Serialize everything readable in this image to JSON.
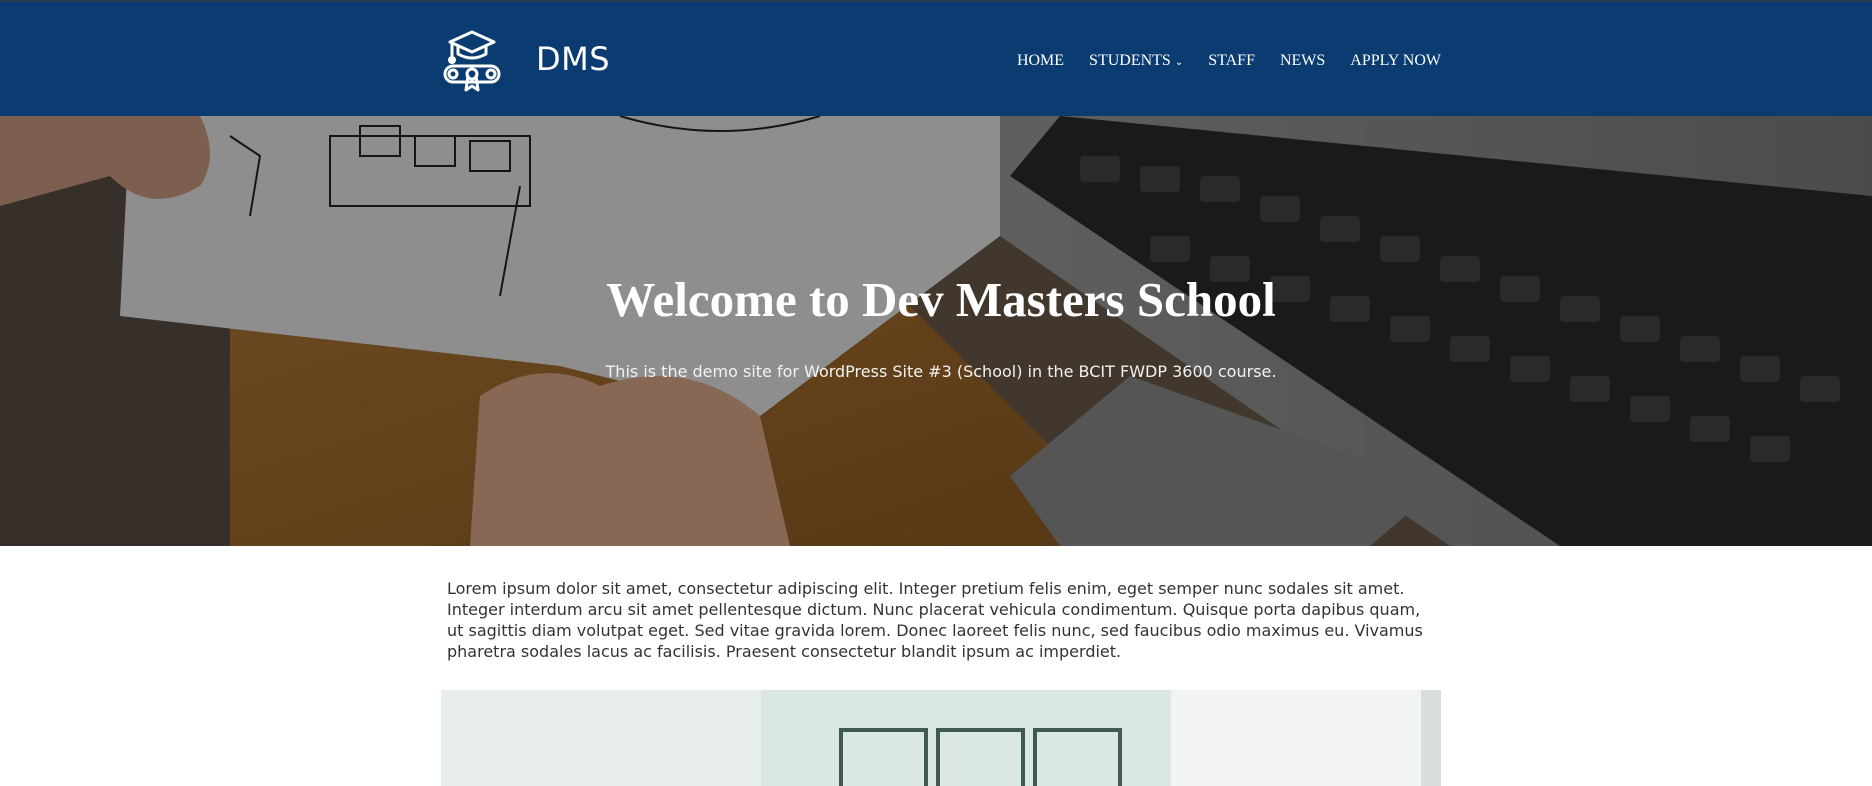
{
  "site": {
    "title": "DMS",
    "logo_icon": "graduation-cap-diploma-icon"
  },
  "nav": {
    "items": [
      {
        "label": "HOME"
      },
      {
        "label": "STUDENTS",
        "has_dropdown": true,
        "dropdown_icon": "chevron-down-icon"
      },
      {
        "label": "STAFF"
      },
      {
        "label": "NEWS"
      },
      {
        "label": "APPLY NOW"
      }
    ]
  },
  "hero": {
    "title": "Welcome to Dev Masters School",
    "subtitle": "This is the demo site for WordPress Site #3 (School) in the BCIT FWDP 3600 course."
  },
  "content": {
    "intro": "Lorem ipsum dolor sit amet, consectetur adipiscing elit. Integer pretium felis enim, eget semper nunc sodales sit amet. Integer interdum arcu sit amet pellentesque dictum. Nunc placerat vehicula condimentum. Quisque porta dapibus quam, ut sagittis diam volutpat eget. Sed vitae gravida lorem. Donec laoreet felis nunc, sed faucibus odio maximus eu. Vivamus pharetra sodales lacus ac facilisis. Praesent consectetur blandit ipsum ac imperdiet."
  },
  "colors": {
    "header_bg": "#0a3c72",
    "nav_text": "#ffffff",
    "body_text": "#333333"
  }
}
